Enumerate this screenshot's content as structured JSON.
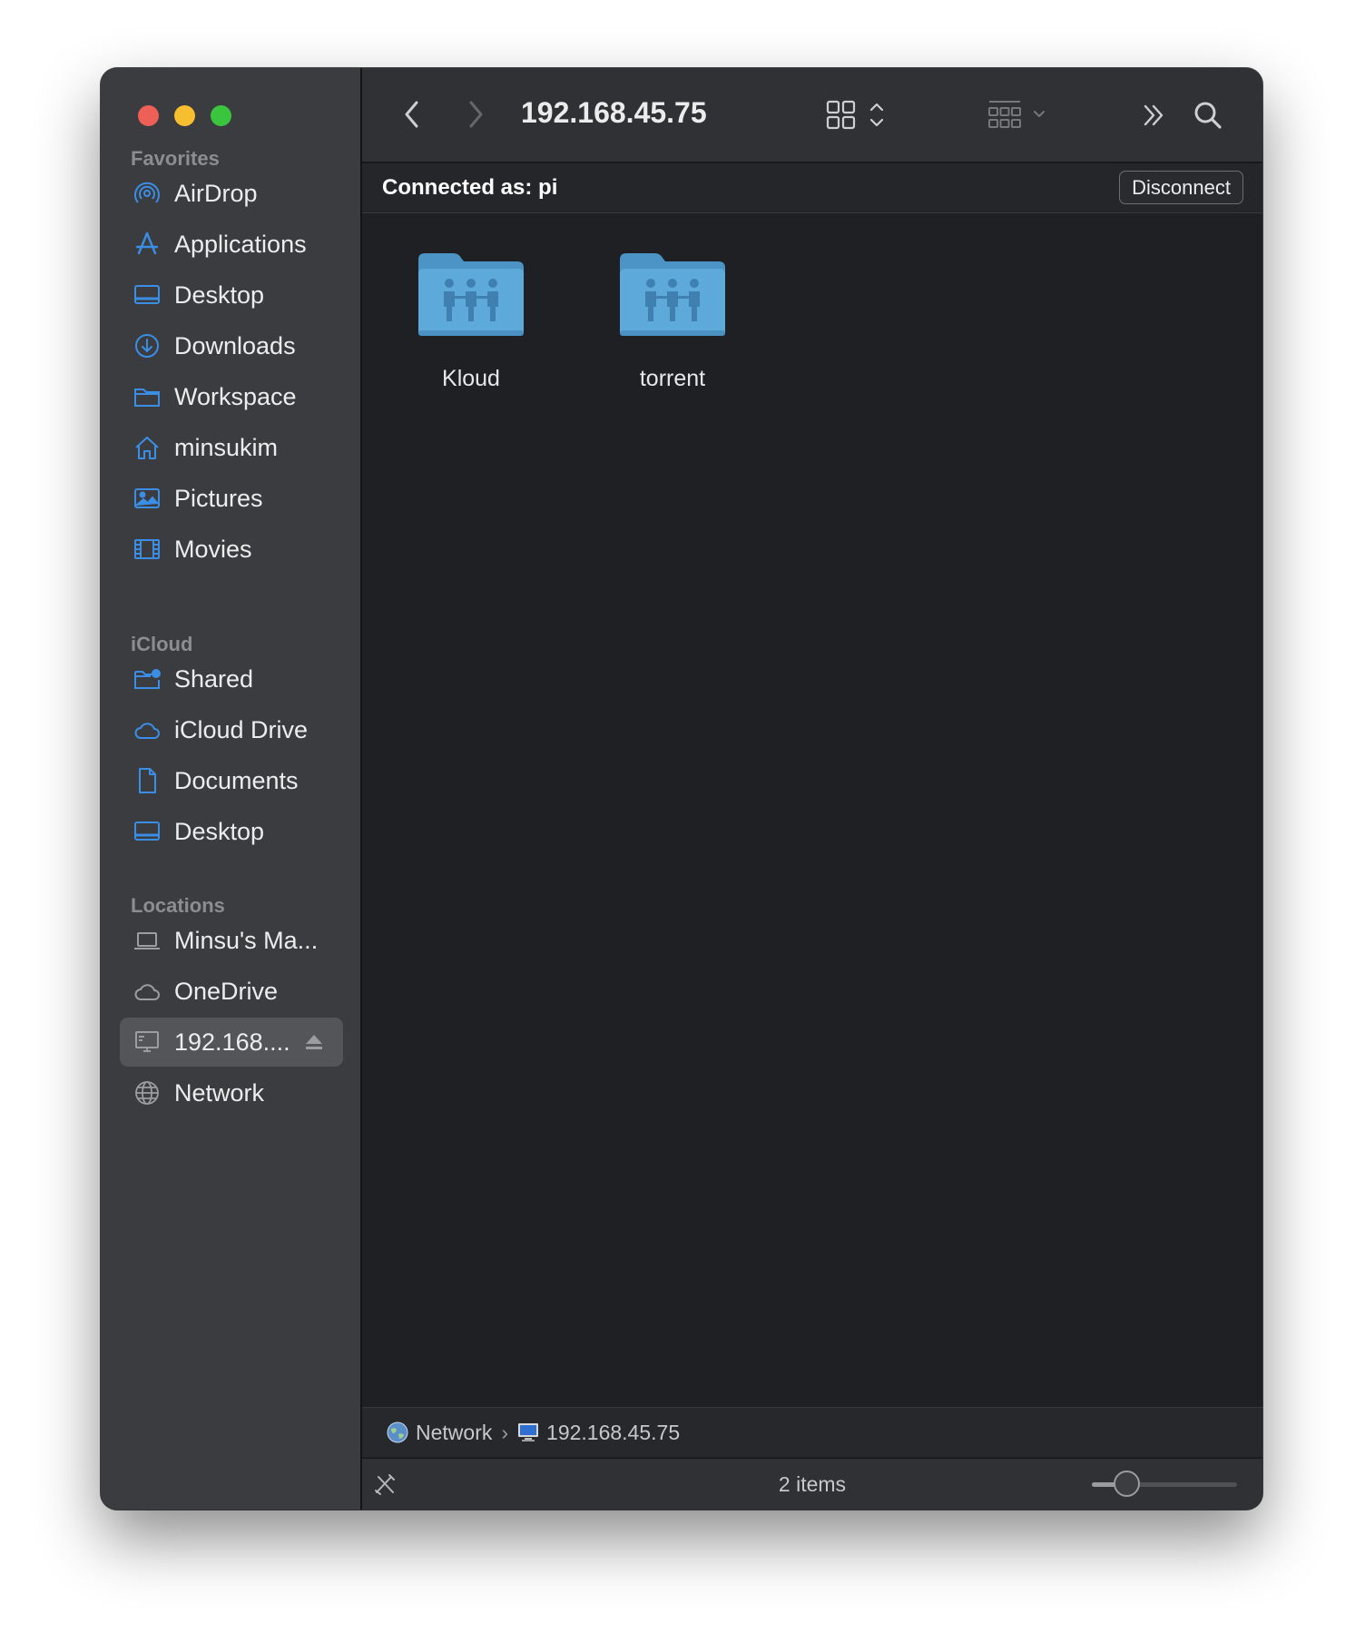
{
  "window": {
    "title": "192.168.45.75",
    "connected_as": "Connected as: pi",
    "disconnect_label": "Disconnect"
  },
  "sidebar": {
    "favorites_title": "Favorites",
    "favorites": [
      {
        "label": "AirDrop",
        "icon": "airdrop-icon"
      },
      {
        "label": "Applications",
        "icon": "applications-icon"
      },
      {
        "label": "Desktop",
        "icon": "desktop-icon"
      },
      {
        "label": "Downloads",
        "icon": "downloads-icon"
      },
      {
        "label": "Workspace",
        "icon": "folder-icon"
      },
      {
        "label": "minsukim",
        "icon": "home-icon"
      },
      {
        "label": "Pictures",
        "icon": "pictures-icon"
      },
      {
        "label": "Movies",
        "icon": "movies-icon"
      }
    ],
    "icloud_title": "iCloud",
    "icloud": [
      {
        "label": "Shared",
        "icon": "shared-folder-icon"
      },
      {
        "label": "iCloud Drive",
        "icon": "icloud-icon"
      },
      {
        "label": "Documents",
        "icon": "document-icon"
      },
      {
        "label": "Desktop",
        "icon": "desktop-icon"
      }
    ],
    "locations_title": "Locations",
    "locations": [
      {
        "label": "Minsu's Ma...",
        "icon": "laptop-icon"
      },
      {
        "label": "OneDrive",
        "icon": "cloud-icon"
      },
      {
        "label": "192.168....",
        "icon": "network-server-icon",
        "selected": true
      },
      {
        "label": "Network",
        "icon": "globe-icon"
      }
    ]
  },
  "files": [
    {
      "name": "Kloud",
      "icon": "shared-folder-icon"
    },
    {
      "name": "torrent",
      "icon": "shared-folder-icon"
    }
  ],
  "pathbar": {
    "items": [
      "Network",
      "192.168.45.75"
    ]
  },
  "statusbar": {
    "items_text": "2 items",
    "icon_size_fraction": 0.24
  },
  "colors": {
    "accent": "#3a8ee6",
    "folder": "#5aa8d8",
    "traffic_close": "#ee5f58",
    "traffic_min": "#f7be2f",
    "traffic_max": "#3bc53f"
  }
}
